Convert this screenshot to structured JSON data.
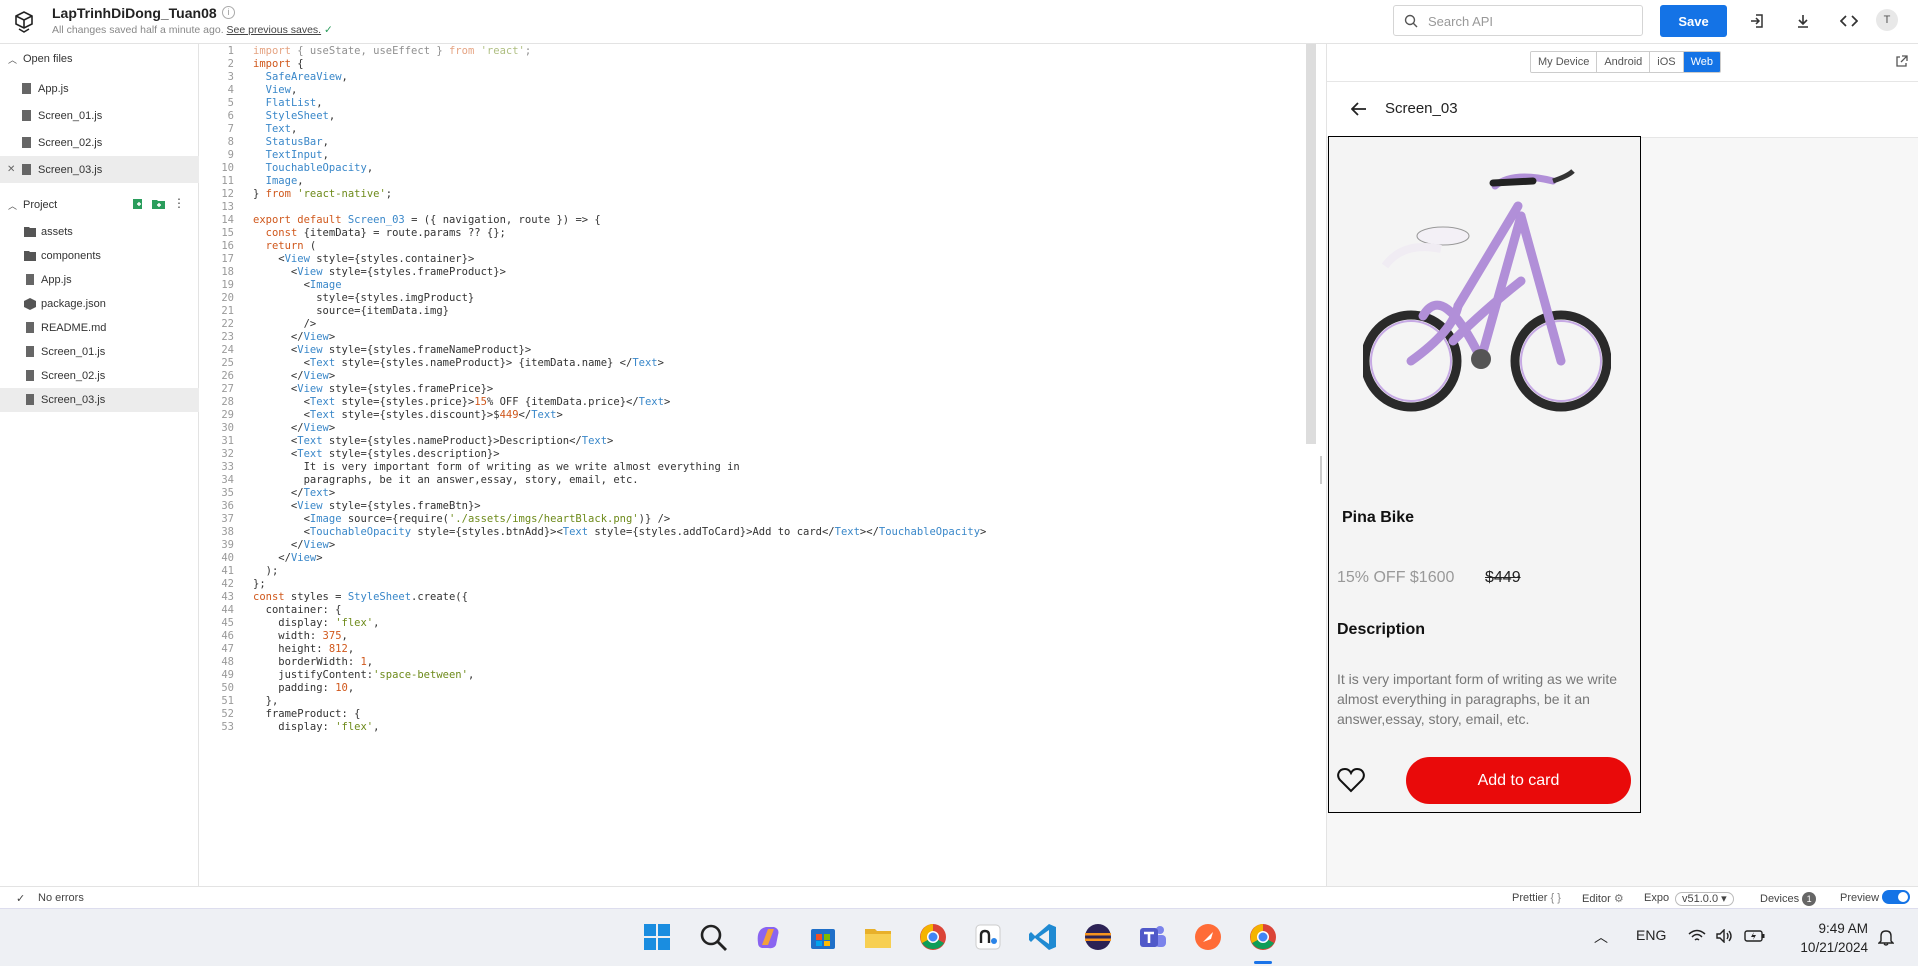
{
  "header": {
    "project_title": "LapTrinhDiDong_Tuan08",
    "save_status": "All changes saved half a minute ago.",
    "previous_saves_link": "See previous saves.",
    "search_placeholder": "Search API",
    "save_label": "Save",
    "avatar_initial": "T"
  },
  "sidebar": {
    "open_files_label": "Open files",
    "open_files": [
      {
        "name": "App.js"
      },
      {
        "name": "Screen_01.js"
      },
      {
        "name": "Screen_02.js"
      },
      {
        "name": "Screen_03.js"
      }
    ],
    "project_label": "Project",
    "project_items": [
      {
        "name": "assets",
        "kind": "folder"
      },
      {
        "name": "components",
        "kind": "folder"
      },
      {
        "name": "App.js",
        "kind": "file"
      },
      {
        "name": "package.json",
        "kind": "package"
      },
      {
        "name": "README.md",
        "kind": "file"
      },
      {
        "name": "Screen_01.js",
        "kind": "file"
      },
      {
        "name": "Screen_02.js",
        "kind": "file"
      },
      {
        "name": "Screen_03.js",
        "kind": "file"
      }
    ]
  },
  "editor": {
    "lines": [
      "import { useState, useEffect } from 'react';",
      "import {",
      "  SafeAreaView,",
      "  View,",
      "  FlatList,",
      "  StyleSheet,",
      "  Text,",
      "  StatusBar,",
      "  TextInput,",
      "  TouchableOpacity,",
      "  Image,",
      "} from 'react-native';",
      "",
      "export default Screen_03 = ({ navigation, route }) => {",
      "  const {itemData} = route.params ?? {};",
      "  return (",
      "    <View style={styles.container}>",
      "      <View style={styles.frameProduct}>",
      "        <Image",
      "          style={styles.imgProduct}",
      "          source={itemData.img}",
      "        />",
      "      </View>",
      "      <View style={styles.frameNameProduct}>",
      "        <Text style={styles.nameProduct}> {itemData.name} </Text>",
      "      </View>",
      "      <View style={styles.framePrice}>",
      "        <Text style={styles.price}>15% OFF {itemData.price}</Text>",
      "        <Text style={styles.discount}>$449</Text>",
      "      </View>",
      "      <Text style={styles.nameProduct}>Description</Text>",
      "      <Text style={styles.description}>",
      "        It is very important form of writing as we write almost everything in",
      "        paragraphs, be it an answer,essay, story, email, etc.",
      "      </Text>",
      "      <View style={styles.frameBtn}>",
      "        <Image source={require('./assets/imgs/heartBlack.png')} />",
      "        <TouchableOpacity style={styles.btnAdd}><Text style={styles.addToCard}>Add to card</Text></TouchableOpacity>",
      "      </View>",
      "    </View>",
      "  );",
      "};",
      "const styles = StyleSheet.create({",
      "  container: {",
      "    display: 'flex',",
      "    width: 375,",
      "    height: 812,",
      "    borderWidth: 1,",
      "    justifyContent:'space-between',",
      "    padding: 10,",
      "  },",
      "  frameProduct: {",
      "    display: 'flex',"
    ]
  },
  "preview": {
    "platform_tabs": [
      "My Device",
      "Android",
      "iOS",
      "Web"
    ],
    "selected_tab": "Web",
    "screen_title": "Screen_03",
    "product_name": "Pina Bike",
    "price": "15% OFF $1600",
    "old_price": "$449",
    "description_title": "Description",
    "description": "It is very important form of writing as we write almost everything in paragraphs, be it an answer,essay, story, email, etc.",
    "add_button": "Add to card",
    "accent_color": "#e90a0a"
  },
  "statusbar": {
    "errors": "No errors",
    "prettier": "Prettier",
    "prettier_glyph": "{ }",
    "editor": "Editor",
    "expo": "Expo",
    "expo_version": "v51.0.0",
    "devices": "Devices",
    "devices_count": "1",
    "preview": "Preview"
  },
  "taskbar": {
    "language": "ENG",
    "time": "9:49 AM",
    "date": "10/21/2024"
  }
}
